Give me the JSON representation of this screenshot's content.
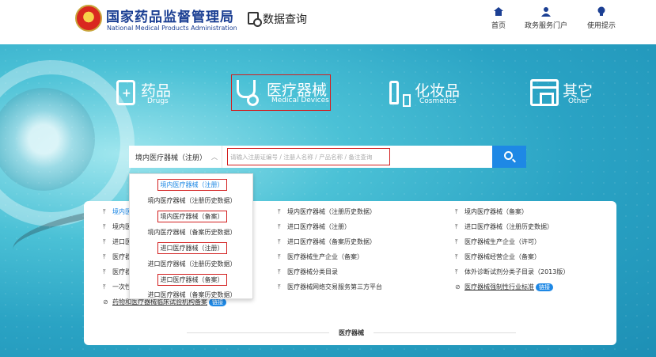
{
  "header": {
    "agency_cn": "国家药品监督管理局",
    "agency_en": "National Medical Products Administration",
    "data_query": "数据查询",
    "nav": [
      {
        "label": "首页",
        "icon": "home-icon"
      },
      {
        "label": "政务服务门户",
        "icon": "user-icon"
      },
      {
        "label": "使用提示",
        "icon": "lightbulb-icon"
      }
    ]
  },
  "categories": [
    {
      "cn": "药品",
      "en": "Drugs",
      "icon": "drug-box-icon"
    },
    {
      "cn": "医疗器械",
      "en": "Medical Devices",
      "icon": "stethoscope-icon"
    },
    {
      "cn": "化妆品",
      "en": "Cosmetics",
      "icon": "cosmetics-icon"
    },
    {
      "cn": "其它",
      "en": "Other",
      "icon": "store-icon"
    }
  ],
  "search": {
    "scope_value": "境内医疗器械（注册）",
    "placeholder": "请输入注册证编号 / 注册人名称 / 产品名称 / 备注查询"
  },
  "dropdown": {
    "options": [
      "境内医疗器械（注册）",
      "境内医疗器械（注册历史数据）",
      "境内医疗器械（备案）",
      "境内医疗器械（备案历史数据）",
      "进口医疗器械（注册）",
      "进口医疗器械（注册历史数据）",
      "进口医疗器械（备案）",
      "进口医疗器械（备案历史数据）"
    ]
  },
  "panel": {
    "col1": [
      "境内医",
      "境内医",
      "进口医",
      "医疗器",
      "医疗器",
      "一次性"
    ],
    "col1_last": "药物和医疗器械临床试验机构备案",
    "col1_last_badge": "链接",
    "col2": [
      "境内医疗器械（注册历史数据）",
      "进口医疗器械（注册）",
      "进口医疗器械（备案历史数据）",
      "医疗器械生产企业（备案）",
      "医疗器械分类目录",
      "医疗器械网络交易服务第三方平台"
    ],
    "col3": [
      "境内医疗器械（备案）",
      "进口医疗器械（注册历史数据）",
      "医疗器械生产企业（许可）",
      "医疗器械经营企业（备案）",
      "体外诊断试剂分类子目录（2013版）",
      "医疗器械强制性行业标准"
    ],
    "col3_last_badge": "链接",
    "footer_label": "医疗器械"
  }
}
